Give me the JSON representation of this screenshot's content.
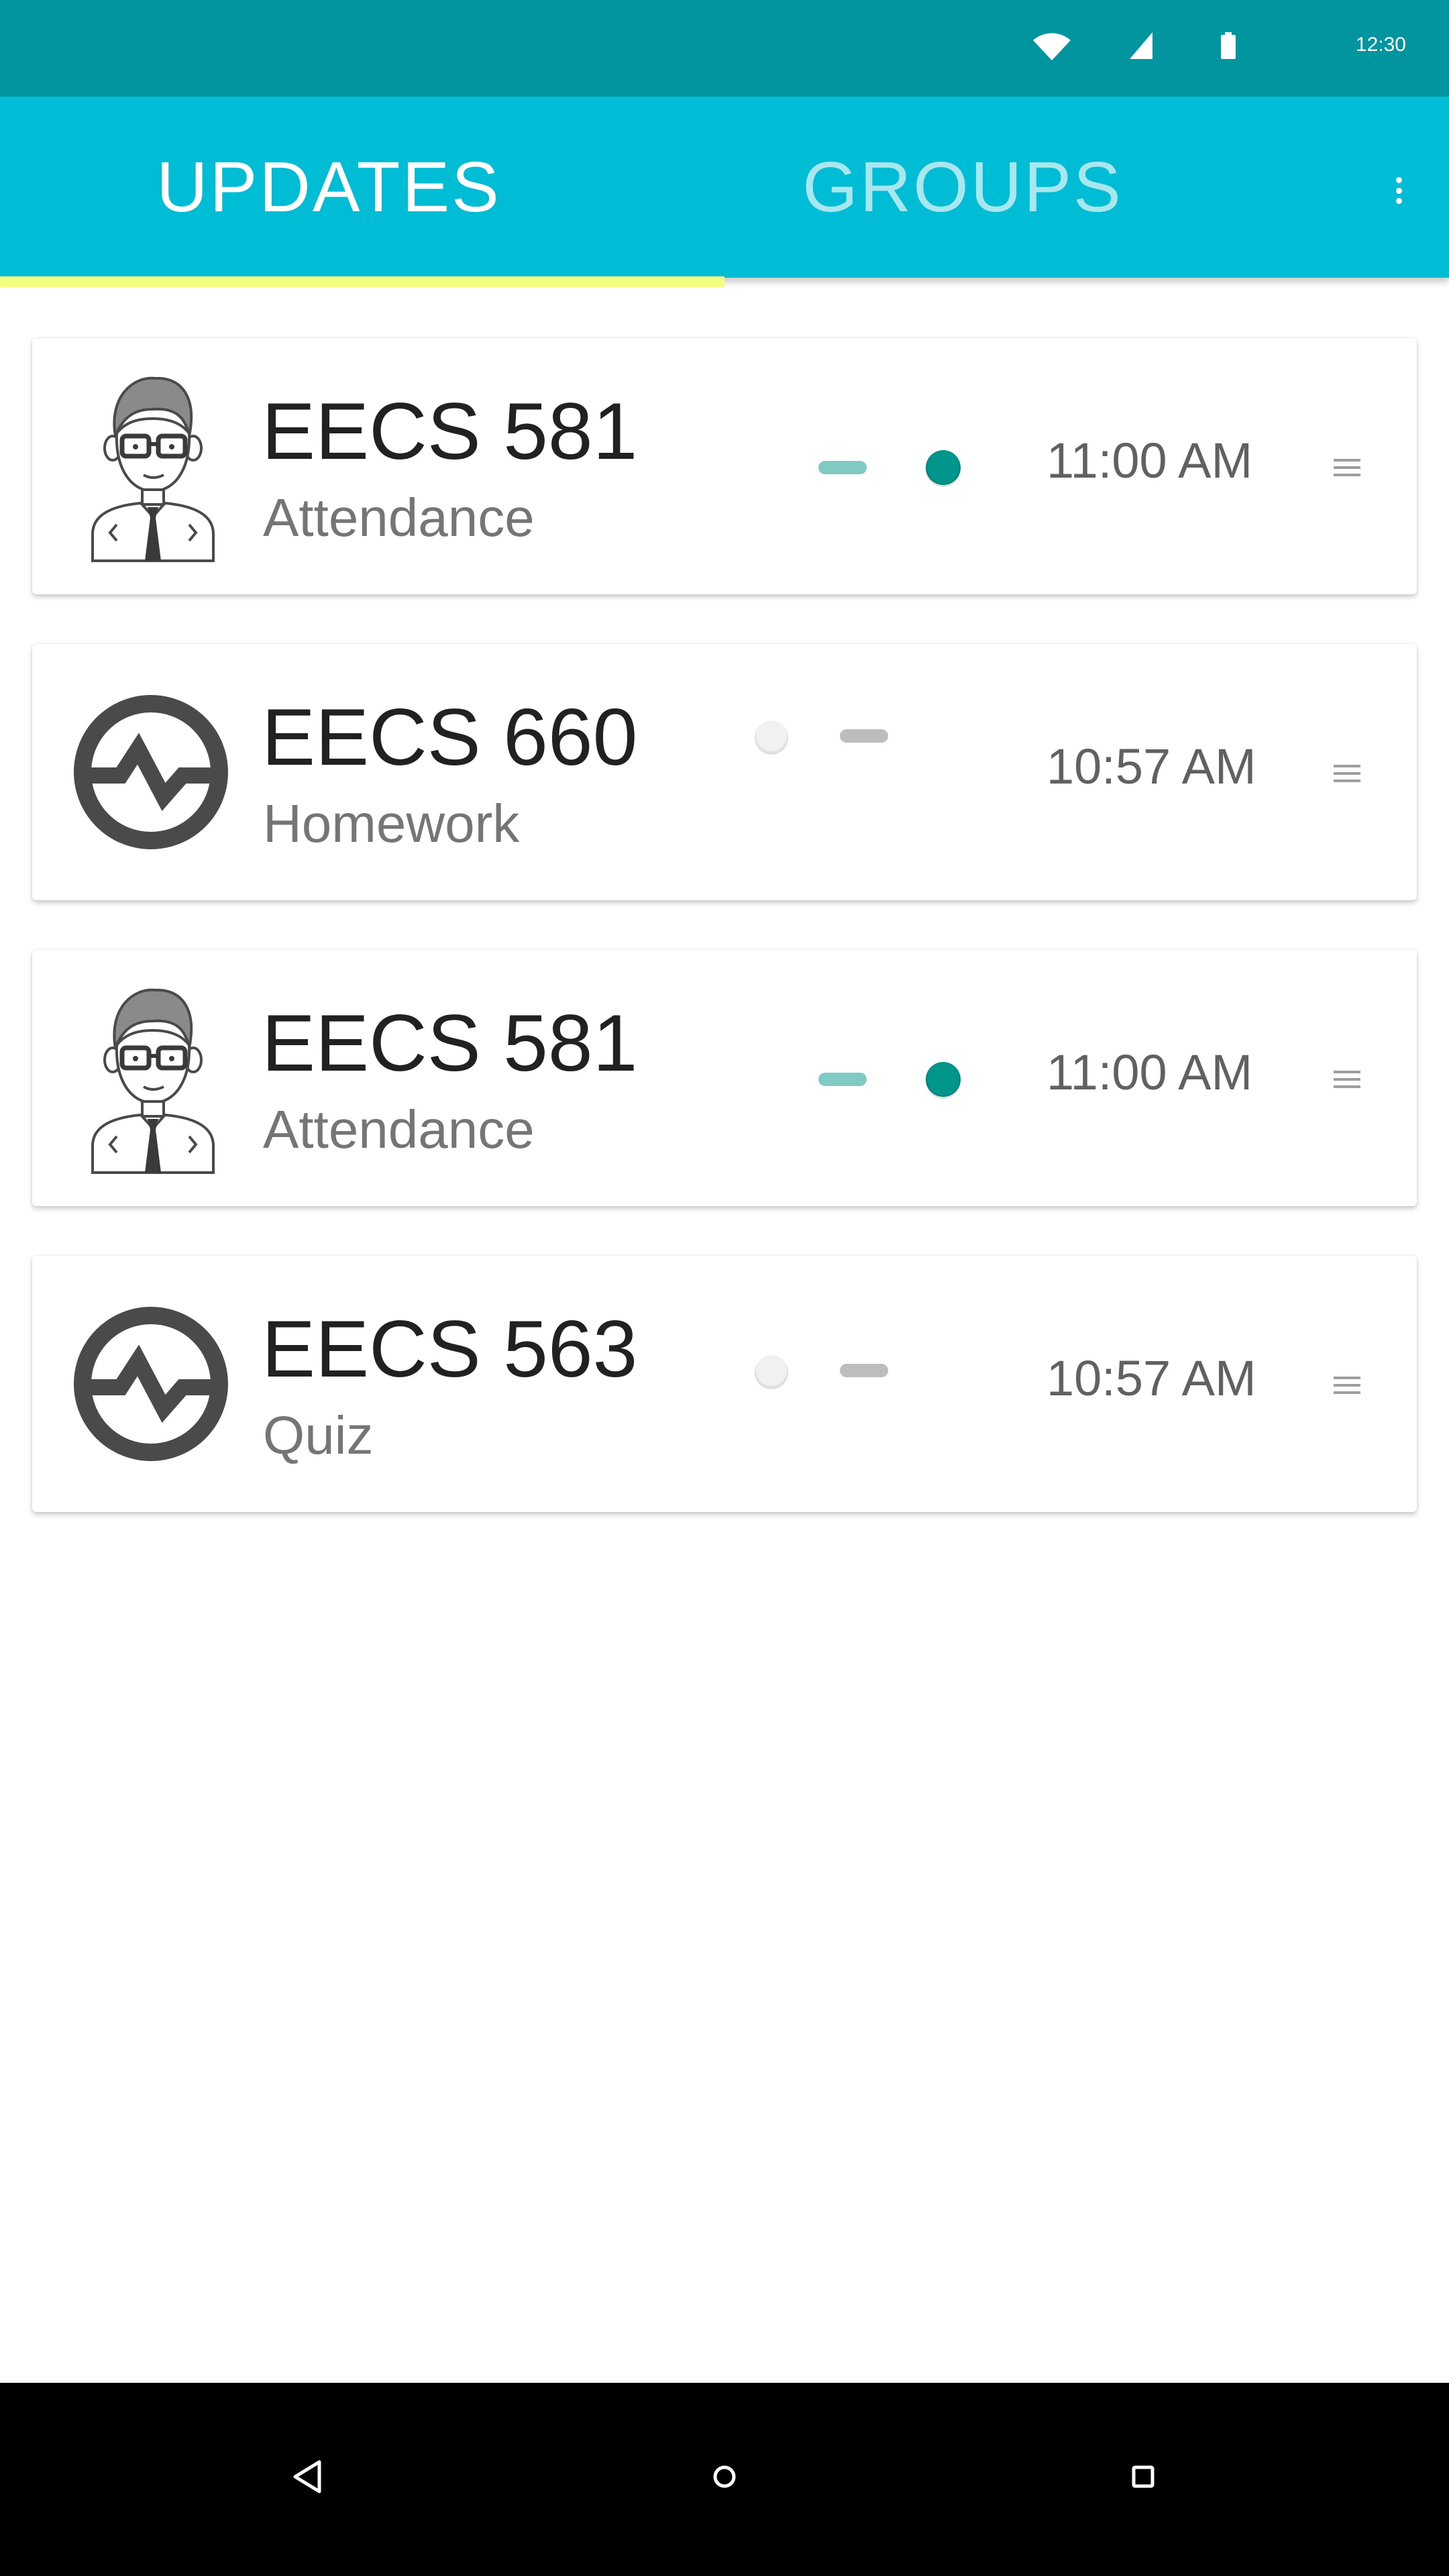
{
  "status_bar": {
    "time": "12:30",
    "icons": [
      "wifi-icon",
      "cell-signal-icon",
      "battery-icon"
    ]
  },
  "tabs": [
    {
      "label": "UPDATES",
      "selected": true
    },
    {
      "label": "GROUPS",
      "selected": false
    }
  ],
  "colors": {
    "status_bar": "#00959f",
    "app_bar": "#00bcd4",
    "tab_indicator": "#f4ff81",
    "toggle_on_thumb": "#00958a",
    "toggle_on_track": "#7fcac3",
    "toggle_off_thumb": "#f1f1f1",
    "toggle_off_track": "#bdbdbd"
  },
  "updates": [
    {
      "title": "EECS 581",
      "subtitle": "Attendance",
      "time": "11:00 AM",
      "avatar": "teacher-avatar-icon",
      "toggle_on": true
    },
    {
      "title": "EECS 660",
      "subtitle": "Homework",
      "time": "10:57 AM",
      "avatar": "activity-pulse-icon",
      "toggle_on": false
    },
    {
      "title": "EECS 581",
      "subtitle": "Attendance",
      "time": "11:00 AM",
      "avatar": "teacher-avatar-icon",
      "toggle_on": true
    },
    {
      "title": "EECS 563",
      "subtitle": "Quiz",
      "time": "10:57 AM",
      "avatar": "activity-pulse-icon",
      "toggle_on": false
    }
  ],
  "nav_bar": {
    "icons": [
      "back-icon",
      "home-icon",
      "recents-icon"
    ]
  }
}
